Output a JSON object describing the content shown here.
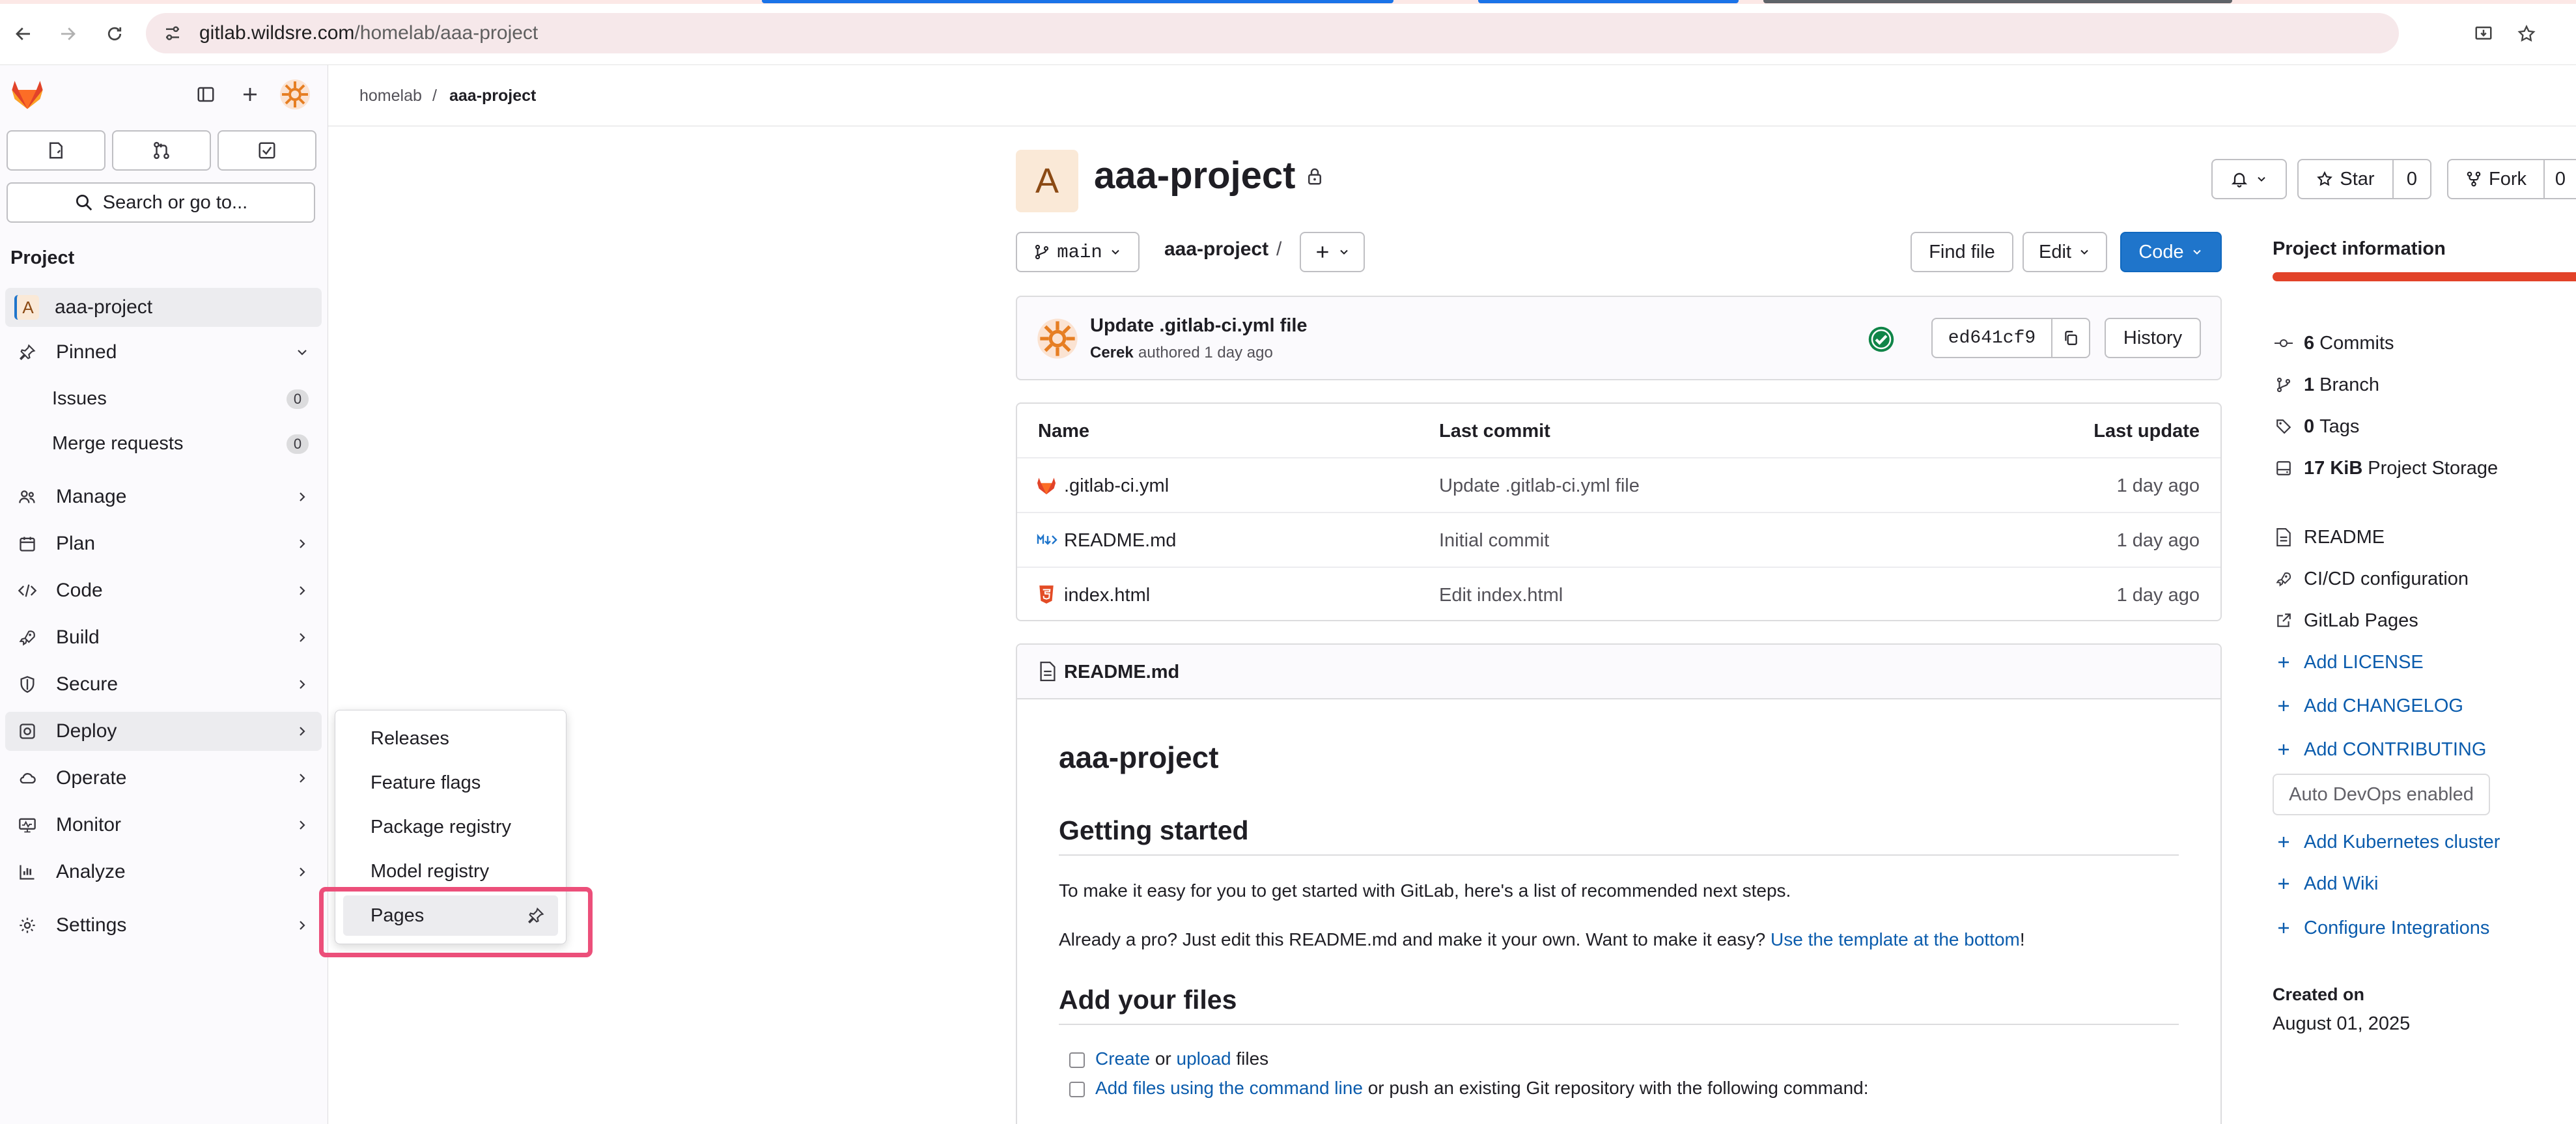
{
  "browser": {
    "url_host": "gitlab.wildsre.com",
    "url_path": "/homelab/aaa-project"
  },
  "sidebar": {
    "search_label": "Search or go to...",
    "section_heading": "Project",
    "project_avatar_letter": "A",
    "project_name": "aaa-project",
    "pinned": {
      "label": "Pinned",
      "items": [
        {
          "label": "Issues",
          "count": "0"
        },
        {
          "label": "Merge requests",
          "count": "0"
        }
      ]
    },
    "nav": [
      {
        "label": "Manage",
        "icon": "manage-icon"
      },
      {
        "label": "Plan",
        "icon": "plan-icon"
      },
      {
        "label": "Code",
        "icon": "code-icon"
      },
      {
        "label": "Build",
        "icon": "rocket-icon"
      },
      {
        "label": "Secure",
        "icon": "shield-icon"
      },
      {
        "label": "Deploy",
        "icon": "deploy-icon"
      },
      {
        "label": "Operate",
        "icon": "cloud-icon"
      },
      {
        "label": "Monitor",
        "icon": "monitor-icon"
      },
      {
        "label": "Analyze",
        "icon": "chart-icon"
      },
      {
        "label": "Settings",
        "icon": "gear-icon"
      }
    ],
    "flyout": [
      "Releases",
      "Feature flags",
      "Package registry",
      "Model registry",
      "Pages"
    ]
  },
  "breadcrumb": {
    "group": "homelab",
    "separator": "/",
    "project": "aaa-project"
  },
  "project": {
    "avatar_letter": "A",
    "title": "aaa-project",
    "star_label": "Star",
    "star_count": "0",
    "fork_label": "Fork",
    "fork_count": "0"
  },
  "repo_toolbar": {
    "branch": "main",
    "path_root": "aaa-project",
    "path_sep": "/",
    "find_file": "Find file",
    "edit": "Edit",
    "code": "Code"
  },
  "last_commit": {
    "title": "Update .gitlab-ci.yml file",
    "author": "Cerek",
    "meta": "authored 1 day ago",
    "sha": "ed641cf9",
    "history": "History"
  },
  "file_table": {
    "headers": [
      "Name",
      "Last commit",
      "Last update"
    ],
    "rows": [
      {
        "name": ".gitlab-ci.yml",
        "icon": "gitlab-file-icon",
        "commit": "Update .gitlab-ci.yml file",
        "updated": "1 day ago"
      },
      {
        "name": "README.md",
        "icon": "markdown-file-icon",
        "commit": "Initial commit",
        "updated": "1 day ago"
      },
      {
        "name": "index.html",
        "icon": "html5-file-icon",
        "commit": "Edit index.html",
        "updated": "1 day ago"
      }
    ]
  },
  "readme": {
    "filename": "README.md",
    "h1": "aaa-project",
    "h2_start": "Getting started",
    "p1": "To make it easy for you to get started with GitLab, here's a list of recommended next steps.",
    "p2_text": "Already a pro? Just edit this README.md and make it your own. Want to make it easy?",
    "p2_link": "Use the template at the bottom",
    "p2_end": "!",
    "h2_files": "Add your files",
    "task1_link1": "Create",
    "task1_mid": "or",
    "task1_link2": "upload",
    "task1_end": "files",
    "task2_link": "Add files using the command line",
    "task2_end": "or push an existing Git repository with the following command:"
  },
  "project_info": {
    "heading": "Project information",
    "stats": [
      {
        "value": "6",
        "label": "Commits",
        "icon": "commit-icon"
      },
      {
        "value": "1",
        "label": "Branch",
        "icon": "branch-icon"
      },
      {
        "value": "0",
        "label": "Tags",
        "icon": "tag-icon"
      },
      {
        "value": "17 KiB",
        "label": "Project Storage",
        "icon": "storage-icon"
      }
    ],
    "links": [
      {
        "label": "README",
        "icon": "document-icon"
      },
      {
        "label": "CI/CD configuration",
        "icon": "rocket-icon"
      },
      {
        "label": "GitLab Pages",
        "icon": "external-link-icon"
      },
      {
        "label": "Add LICENSE",
        "icon": "plus-icon"
      },
      {
        "label": "Add CHANGELOG",
        "icon": "plus-icon"
      },
      {
        "label": "Add CONTRIBUTING",
        "icon": "plus-icon"
      }
    ],
    "auto_devops": "Auto DevOps enabled",
    "links2": [
      {
        "label": "Add Kubernetes cluster",
        "icon": "plus-icon"
      },
      {
        "label": "Add Wiki",
        "icon": "plus-icon"
      },
      {
        "label": "Configure Integrations",
        "icon": "plus-icon"
      }
    ],
    "created_label": "Created on",
    "created_date": "August 01, 2025"
  },
  "colors": {
    "accent": "#1f75cb",
    "tanuki": "#e24329",
    "highlight": "#ec4f7a",
    "success": "#108548"
  }
}
